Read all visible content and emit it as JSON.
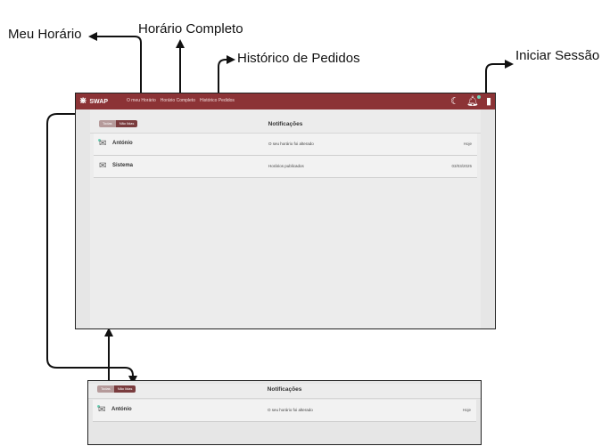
{
  "callouts": {
    "my_schedule": "Meu Horário",
    "full_schedule": "Horário Completo",
    "order_history": "Histórico de Pedidos",
    "login": "Iniciar Sessão"
  },
  "navbar": {
    "brand": "SWAP",
    "links": [
      "O meu Horário",
      "Horário Completo",
      "Histórico Pedidos"
    ],
    "icons": [
      "moon-icon",
      "bell-icon",
      "door-icon"
    ]
  },
  "notifications": {
    "title": "Notificações",
    "filter_all": "Todas",
    "filter_unread": "Não lidas",
    "items": [
      {
        "sender": "António",
        "message": "O seu horário foi alterado",
        "date": "Hoje"
      },
      {
        "sender": "Sistema",
        "message": "Horários publicados",
        "date": "03/03/2025"
      }
    ]
  },
  "detail_view": {
    "title": "Notificações",
    "filter_all": "Todas",
    "filter_unread": "Não lidas",
    "items": [
      {
        "sender": "António",
        "message": "O seu horário foi alterado",
        "date": "Hoje"
      }
    ]
  }
}
